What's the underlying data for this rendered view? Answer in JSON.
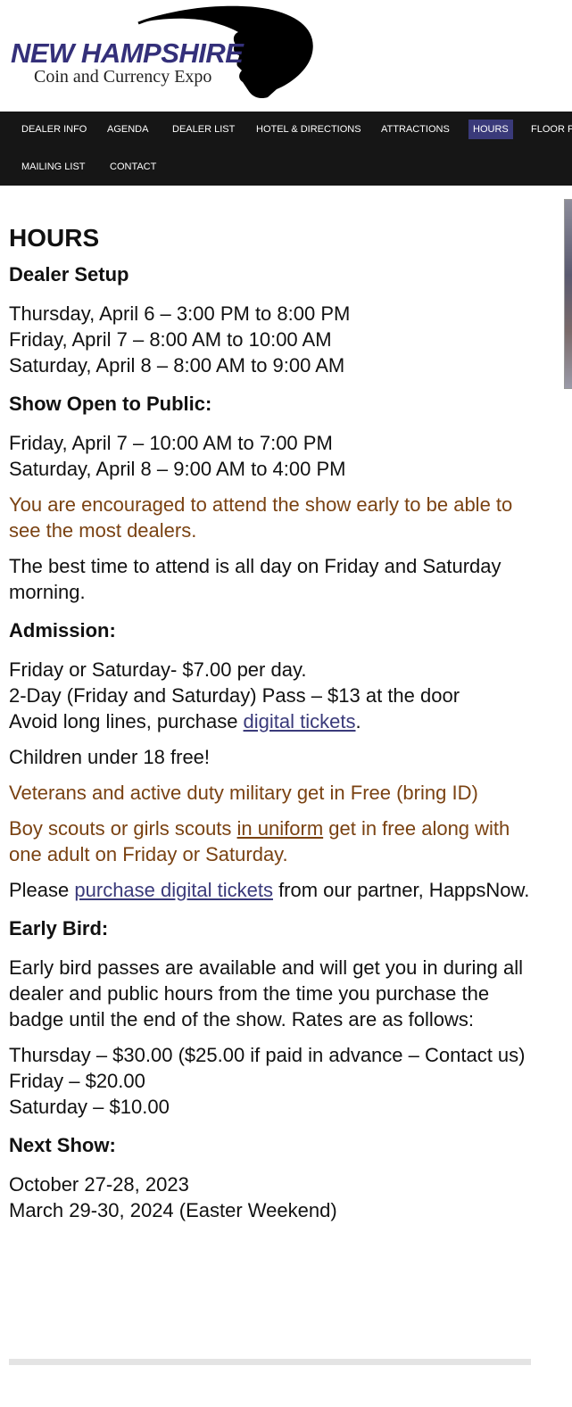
{
  "header": {
    "logo_title": "NEW HAMPSHIRE",
    "logo_subtitle": "Coin and Currency Expo"
  },
  "nav": {
    "items": [
      {
        "label": "DEALER INFO"
      },
      {
        "label": "AGENDA"
      },
      {
        "label": "DEALER LIST"
      },
      {
        "label": "HOTEL & DIRECTIONS"
      },
      {
        "label": "ATTRACTIONS"
      },
      {
        "label": "HOURS",
        "active": true
      },
      {
        "label": "FLOOR PLAN"
      },
      {
        "label": "MAILING LIST"
      },
      {
        "label": "CONTACT"
      }
    ]
  },
  "page": {
    "title": "HOURS",
    "dealer_setup": {
      "heading": "Dealer Setup",
      "lines": [
        "Thursday, April 6 – 3:00 PM to 8:00 PM",
        "Friday, April 7 – 8:00 AM to 10:00 AM",
        "Saturday, April 8 – 8:00 AM to 9:00 AM"
      ]
    },
    "public": {
      "heading": "Show Open to Public:",
      "lines": [
        "Friday, April 7 – 10:00 AM to 7:00 PM",
        "Saturday, April 8 – 9:00 AM to 4:00 PM"
      ],
      "encourage": "You are encouraged to attend the show early to be able to see the most dealers.",
      "best_time": "The best time to attend is all day on Friday and Saturday morning."
    },
    "admission": {
      "heading": "Admission:",
      "line1": "Friday or Saturday- $7.00 per day.",
      "line2": "2-Day (Friday and Saturday) Pass – $13 at the door",
      "line3_prefix": "Avoid long lines, purchase ",
      "line3_link": "digital tickets",
      "line3_suffix": ".",
      "children": "Children under 18 free!",
      "veterans": "Veterans and active duty military get in Free  (bring ID)",
      "scouts_prefix": "Boy scouts or girls scouts ",
      "scouts_link": "in uniform",
      "scouts_suffix": " get in free along with one adult on Friday or Saturday.",
      "purchase_prefix": "Please ",
      "purchase_link": "purchase digital tickets",
      "purchase_suffix": " from our partner, HappsNow."
    },
    "early_bird": {
      "heading": "Early Bird:",
      "desc": "Early bird passes are available and will get you in during all dealer and public hours from the time you purchase the badge until the end of the show. Rates are as follows:",
      "rates": [
        "Thursday – $30.00 ($25.00 if paid in advance – Contact us)",
        "Friday – $20.00",
        "Saturday – $10.00"
      ]
    },
    "next_show": {
      "heading": "Next Show:",
      "lines": [
        "October 27-28, 2023",
        "March 29-30, 2024 (Easter Weekend)"
      ]
    }
  },
  "colors": {
    "brand": "#34307a",
    "nav_bg": "#161616",
    "nav_active": "#3a3a7a",
    "warning_text": "#7a4212",
    "link": "#3a3a7a"
  }
}
